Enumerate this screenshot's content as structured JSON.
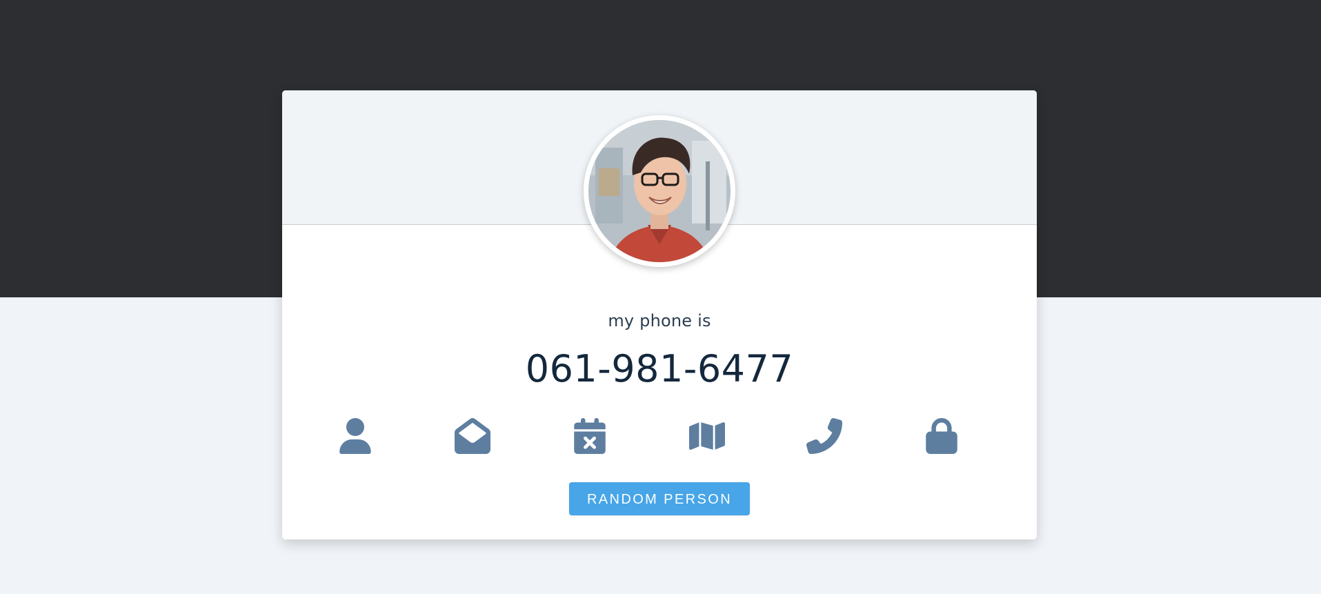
{
  "profile": {
    "title_text": "my phone is",
    "value_text": "061-981-6477",
    "avatar_icon": "user-portrait-photo"
  },
  "icons": [
    {
      "name": "user-icon",
      "label": "name"
    },
    {
      "name": "envelope-open-icon",
      "label": "email"
    },
    {
      "name": "calendar-times-icon",
      "label": "birthday"
    },
    {
      "name": "map-icon",
      "label": "address"
    },
    {
      "name": "phone-icon",
      "label": "phone"
    },
    {
      "name": "lock-icon",
      "label": "password"
    }
  ],
  "actions": {
    "random_label": "RANDOM PERSON"
  },
  "colors": {
    "top_band": "#2d2e32",
    "page_background": "#f0f4f8",
    "card_header": "#f0f4f7",
    "icon": "#5e7ea0",
    "button": "#47a5e8",
    "value_text": "#14283c"
  }
}
